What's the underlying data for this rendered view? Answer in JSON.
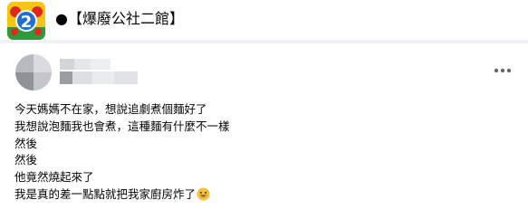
{
  "group": {
    "name": "●【爆廢公社二館】",
    "logo_text": "2"
  },
  "post": {
    "lines": [
      "今天媽媽不在家，想說追劇煮個麵好了",
      "我想說泡麵我也會煮，這種麵有什麼不一樣",
      "然後",
      "然後",
      "他竟然燒起來了",
      "我是真的差一點點就把我家廚房炸了"
    ],
    "emoji": "grinning-sweat-emoji"
  },
  "icons": {
    "more": "more-horizontal-icon"
  },
  "colors": {
    "background": "#f0f2f5",
    "text": "#050505",
    "icon": "#65676b"
  }
}
